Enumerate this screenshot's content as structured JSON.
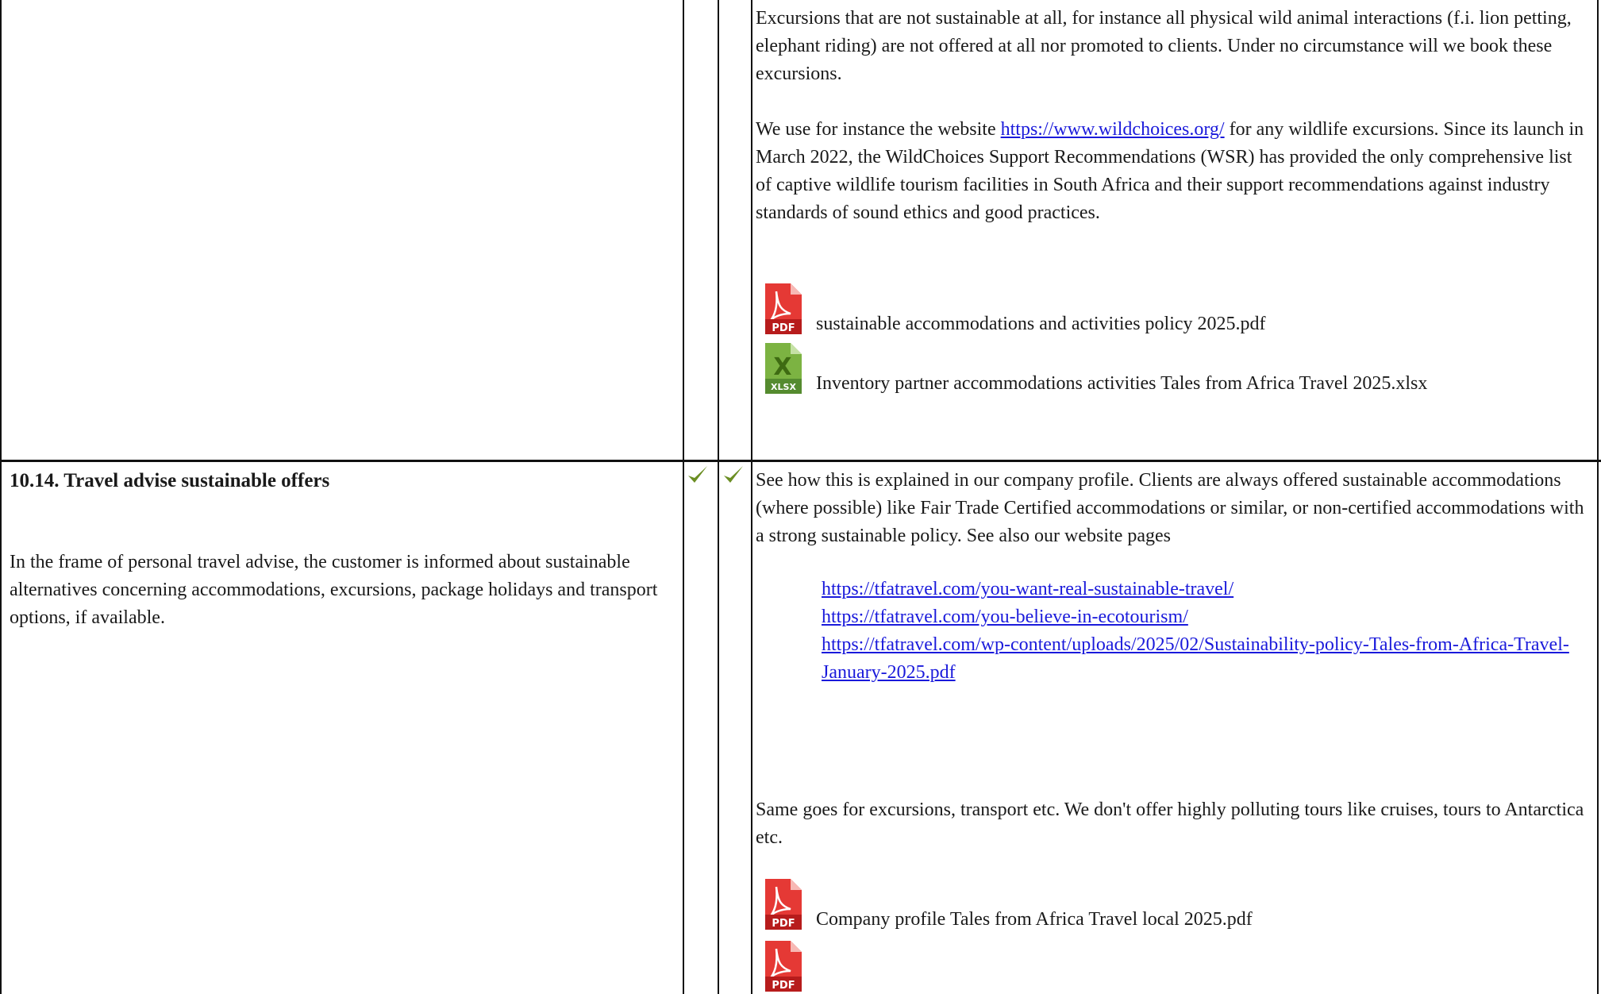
{
  "top_block": {
    "para1": "Excursions that are not sustainable at all, for instance all physical wild animal interactions (f.i. lion petting, elephant riding) are not offered at all nor promoted to clients. Under no circumstance will we book these excursions.",
    "para2_before": "We use for instance the website",
    "para2_link": "https://www.wildchoices.org/",
    "para2_after": "for any wildlife excursions. Since its launch in March 2022, the WildChoices Support Recommendations (WSR) has provided the only comprehensive list of captive wildlife tourism facilities in South Africa and their support recommendations against industry standards of sound ethics and good practices.",
    "attachments": [
      {
        "type": "PDF",
        "name": "sustainable accommodations and activities policy 2025.pdf"
      },
      {
        "type": "XLSX",
        "name": "Inventory partner accommodations activities Tales from Africa Travel 2025.xlsx"
      }
    ]
  },
  "requirement": {
    "title": "10.14. Travel advise sustainable offers",
    "description": "In the frame of personal travel advise, the customer is informed about sustainable alternatives concerning accommodations, excursions, package holidays and transport options, if available.",
    "check1_icon": "checkmark-icon",
    "check2_icon": "checkmark-icon",
    "check_color": "#6b8e23"
  },
  "response": {
    "intro": "See how this is explained in our company profile. Clients are always offered sustainable accommodations (where possible) like Fair Trade Certified accommodations or similar, or non-certified accommodations with a strong sustainable policy. See also our website pages",
    "links": [
      "https://tfatravel.com/you-want-real-sustainable-travel/",
      "https://tfatravel.com/you-believe-in-ecotourism/",
      "https://tfatravel.com/wp-content/uploads/2025/02/Sustainability-policy-Tales-from-Africa-Travel-January-2025.pdf"
    ],
    "para2": "Same goes for excursions, transport etc. We don't offer highly polluting tours like cruises, tours to Antarctica etc.",
    "attachments": [
      {
        "type": "PDF",
        "name": "Company profile Tales from Africa Travel local 2025.pdf"
      },
      {
        "type": "PDF",
        "name": ""
      }
    ]
  },
  "colors": {
    "link": "#1a1adb",
    "pdf_red": "#d42a20",
    "xlsx_green": "#6aaa2a",
    "grid": "#111111"
  }
}
